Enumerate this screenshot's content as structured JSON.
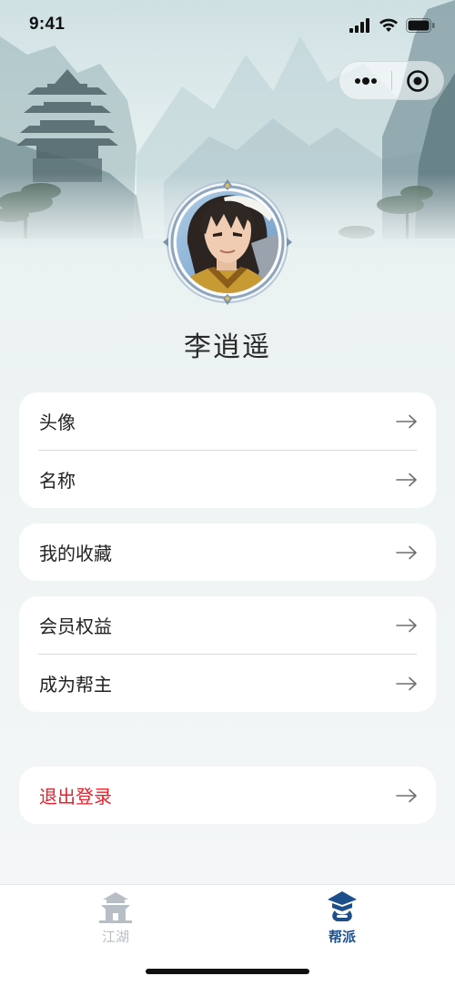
{
  "status_bar": {
    "time": "9:41"
  },
  "capsule": {
    "more_icon": "more-dots-icon",
    "close_icon": "target-close-icon"
  },
  "profile": {
    "name": "李逍遥",
    "avatar_icon": "character-avatar"
  },
  "menu": {
    "group1": [
      {
        "label": "头像"
      },
      {
        "label": "名称"
      }
    ],
    "group2": [
      {
        "label": "我的收藏"
      }
    ],
    "group3": [
      {
        "label": "会员权益"
      },
      {
        "label": "成为帮主"
      }
    ],
    "logout": {
      "label": "退出登录"
    }
  },
  "colors": {
    "danger": "#e8212b",
    "tab_active": "#1c4f8c",
    "tab_inactive": "#b8bec6"
  },
  "tabbar": {
    "tabs": [
      {
        "label": "江湖",
        "icon": "pavilion-icon",
        "active": false
      },
      {
        "label": "帮派",
        "icon": "sect-hat-icon",
        "active": true
      }
    ]
  }
}
